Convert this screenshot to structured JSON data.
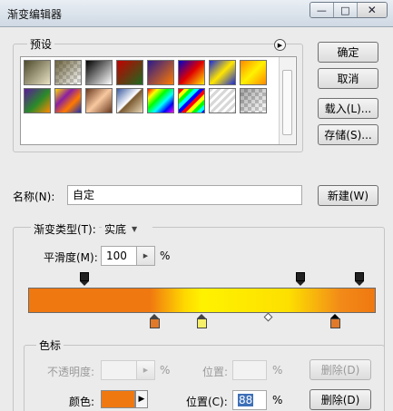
{
  "window": {
    "title": "渐变编辑器",
    "controls": {
      "minimize": "—",
      "maximize": "□",
      "close": "✕"
    }
  },
  "presets": {
    "label": "预设",
    "flyout_icon": "play-icon",
    "swatches": [
      {
        "name": "foreground-to-background",
        "css": "linear-gradient(135deg,#4e4a2c,#e9e3c4)"
      },
      {
        "name": "foreground-to-transparent",
        "css": "linear-gradient(135deg,rgba(90,80,40,0.9),rgba(255,255,255,0))"
      },
      {
        "name": "black-white",
        "css": "linear-gradient(135deg,#000,#fff)"
      },
      {
        "name": "red-green",
        "css": "linear-gradient(135deg,#c00000,#1d6a20)"
      },
      {
        "name": "violet-orange",
        "css": "linear-gradient(135deg,#2a1a8a,#ff7a00)"
      },
      {
        "name": "blue-red-yellow",
        "css": "linear-gradient(135deg,#0000c8,#e00000 50%,#ffe800)"
      },
      {
        "name": "blue-yellow-blue",
        "css": "linear-gradient(135deg,#1a2ad8,#ffe600 50%,#1a2ad8)"
      },
      {
        "name": "orange-yellow-orange",
        "css": "linear-gradient(135deg,#ff8a00,#fff200 50%,#ff8a00)"
      },
      {
        "name": "violet-green-orange",
        "css": "linear-gradient(135deg,#5a1a9a,#2a8a2a 55%,#ff8a00)"
      },
      {
        "name": "yellow-violet-orange-blue",
        "css": "linear-gradient(135deg,#ffd800,#8a20a0 35%,#ff7a00 65%,#2030b0)"
      },
      {
        "name": "copper",
        "css": "linear-gradient(135deg,#6a3a20,#f8c8a0 50%,#6a3a20)"
      },
      {
        "name": "chrome",
        "css": "linear-gradient(135deg,#3a5aa0,#ffffff 48%,#7a5a30 52%,#e8d8b8)"
      },
      {
        "name": "spectrum",
        "css": "linear-gradient(135deg,#ff0000,#ffff00 20%,#00ff00 40%,#00ffff 60%,#0000ff 80%,#ff00ff)"
      },
      {
        "name": "transparent-rainbow",
        "css": "repeating-linear-gradient(135deg,#ff0000 0 4px,#ffff00 4px 8px,#00ff00 8px 12px,#00ffff 12px 16px,#0000ff 16px 20px)"
      },
      {
        "name": "transparent-stripes",
        "css": "repeating-linear-gradient(135deg,#d8d8d8 0 3px,#ffffff 3px 6px)"
      },
      {
        "name": "neutral-density",
        "css": "linear-gradient(135deg,rgba(0,0,0,0.35),rgba(255,255,255,0))"
      }
    ]
  },
  "buttons": {
    "ok": "确定",
    "cancel": "取消",
    "load": "载入(L)...",
    "save": "存储(S)...",
    "new": "新建(W)",
    "delete_opacity": "删除(D)",
    "delete_color": "删除(D)"
  },
  "name_field": {
    "label": "名称(N):",
    "value": "自定"
  },
  "gradient_type": {
    "label": "渐变类型(T):",
    "value": "实底",
    "arrow_icon": "chevron-down-icon"
  },
  "smoothness": {
    "label": "平滑度(M):",
    "value": "100",
    "unit": "%"
  },
  "gradient": {
    "css": "linear-gradient(to right,#f07810 0%,#f07810 35%,#ffd800 45%,#fff200 50%,#fde000 75%,#f28a18 90%,#f07810 100%)",
    "opacity_stops_count": 3,
    "color_stops": [
      {
        "color": "#e07a2a",
        "selected": false
      },
      {
        "color": "#f6ef6a",
        "selected": false
      },
      {
        "color": "#e07a2a",
        "selected": true
      }
    ]
  },
  "stops_group": {
    "label": "色标",
    "opacity_label": "不透明度:",
    "opacity_value": "",
    "opacity_unit": "%",
    "opacity_location_label": "位置:",
    "opacity_location_value": "",
    "opacity_location_unit": "%",
    "color_label": "颜色:",
    "color_value": "#f07810",
    "color_location_label": "位置(C):",
    "color_location_value": "88",
    "color_location_unit": "%"
  }
}
